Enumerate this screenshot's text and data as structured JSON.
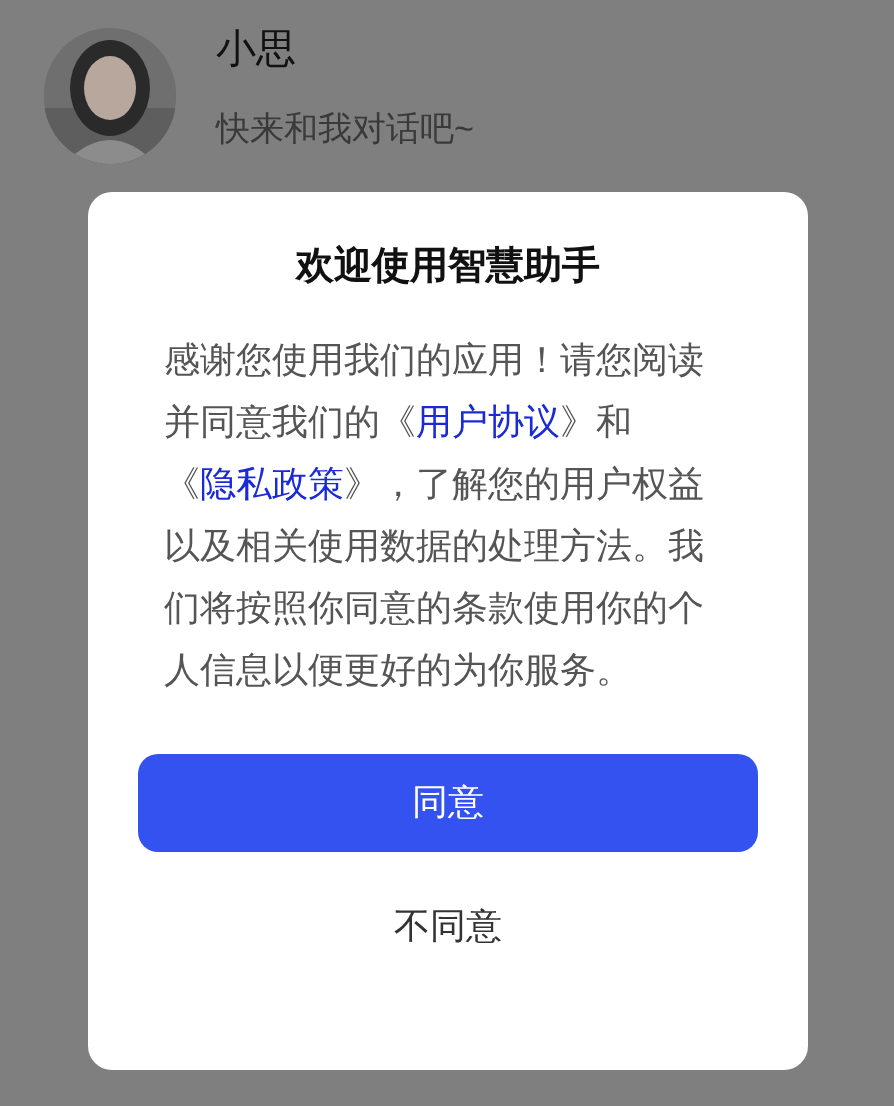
{
  "chat_header": {
    "name": "小思",
    "subtitle": "快来和我对话吧~"
  },
  "dialog": {
    "title": "欢迎使用智慧助手",
    "body": [
      {
        "kind": "text",
        "text": "感谢您使用我们的应用！请您阅读并同意我们的《"
      },
      {
        "kind": "link",
        "text": "用户协议"
      },
      {
        "kind": "text",
        "text": "》和《"
      },
      {
        "kind": "link",
        "text": "隐私政策"
      },
      {
        "kind": "text",
        "text": "》，了解您的用户权益以及相关使用数据的处理方法。我们将按照你同意的条款使用你的个人信息以便更好的为你服务。"
      }
    ],
    "buttons": [
      {
        "kind": "primary",
        "label": "同意"
      },
      {
        "kind": "plain",
        "label": "不同意"
      }
    ]
  }
}
